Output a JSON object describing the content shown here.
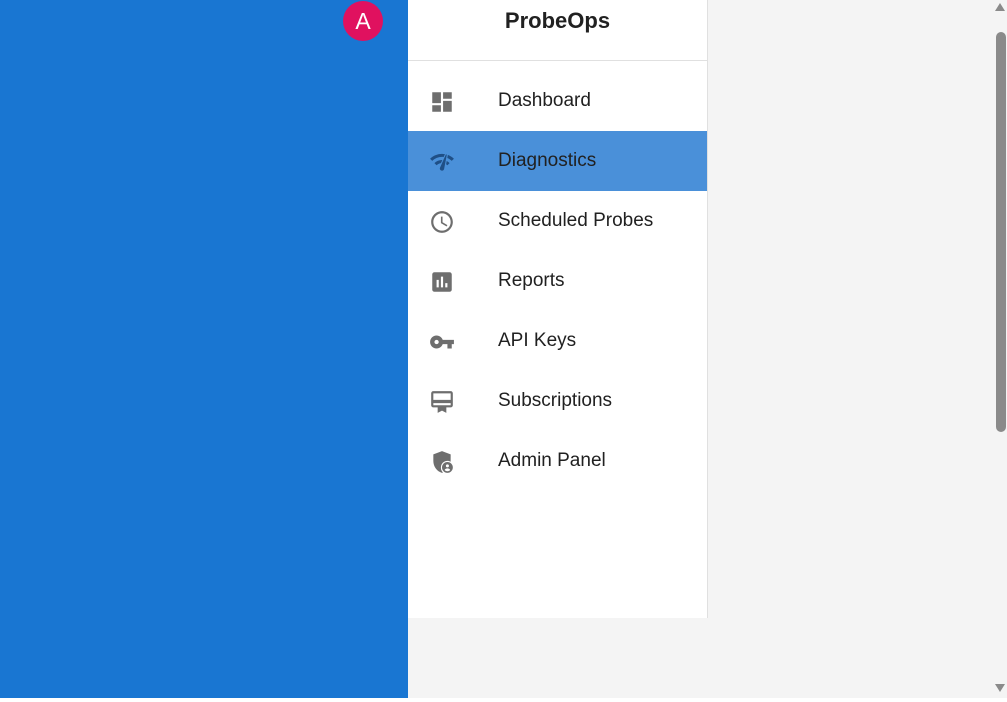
{
  "app": {
    "avatar_initial": "A",
    "brand": "ProbeOps"
  },
  "colors": {
    "side_panel": "#1976d2",
    "avatar": "#e0115f",
    "active_item": "#4a90d9",
    "icon": "#6e6e6e"
  },
  "nav": {
    "items": [
      {
        "label": "Dashboard",
        "icon": "dashboard-icon",
        "active": false
      },
      {
        "label": "Diagnostics",
        "icon": "network-check-icon",
        "active": true
      },
      {
        "label": "Scheduled Probes",
        "icon": "clock-icon",
        "active": false
      },
      {
        "label": "Reports",
        "icon": "bar-chart-icon",
        "active": false
      },
      {
        "label": "API Keys",
        "icon": "key-icon",
        "active": false
      },
      {
        "label": "Subscriptions",
        "icon": "card-membership-icon",
        "active": false
      },
      {
        "label": "Admin Panel",
        "icon": "admin-shield-icon",
        "active": false
      }
    ]
  }
}
